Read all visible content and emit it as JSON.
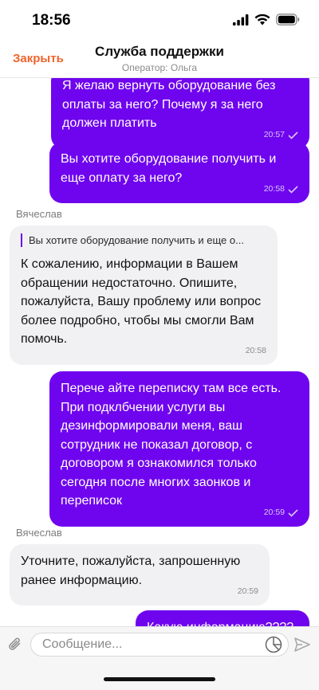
{
  "status_bar": {
    "time": "18:56"
  },
  "header": {
    "close_label": "Закрыть",
    "title": "Служба поддержки",
    "subtitle": "Оператор: Ольга"
  },
  "messages": [
    {
      "direction": "outgoing",
      "text": "Я желаю вернуть оборудование без оплаты за него? Почему я за него должен платить",
      "time": "20:57",
      "read": true
    },
    {
      "direction": "outgoing",
      "text": "Вы хотите оборудование получить и еще оплату за него?",
      "time": "20:58",
      "read": true
    },
    {
      "direction": "incoming",
      "sender": "Вячеслав",
      "quote": "Вы хотите оборудование получить и еще о...",
      "text": "К сожалению, информации в Вашем обращении недостаточно. Опишите, пожалуйста, Вашу проблему или вопрос более подробно, чтобы мы смогли Вам помочь.",
      "time": "20:58"
    },
    {
      "direction": "outgoing",
      "text": "Перече айте переписку там все есть. При подклбчении услуги вы дезинформировали меня, ваш сотрудник не показал договор, с договором я ознакомился только сегодня после многих заонков и переписок",
      "time": "20:59",
      "read": true
    },
    {
      "direction": "incoming",
      "sender": "Вячеслав",
      "text": "Уточните, пожалуйста, запрошенную ранее информацию.",
      "time": "20:59"
    },
    {
      "direction": "outgoing",
      "text": "Какую информацию????",
      "time": "",
      "read": false
    }
  ],
  "input": {
    "placeholder": "Сообщение...",
    "value": ""
  },
  "colors": {
    "accent": "#6f05ee",
    "close_text": "#f0642d",
    "incoming_bubble": "#f1f1f3"
  },
  "icons": {
    "attach": "paperclip-icon",
    "sticker": "sticker-icon",
    "send": "send-icon",
    "read_receipt": "check-icon"
  }
}
